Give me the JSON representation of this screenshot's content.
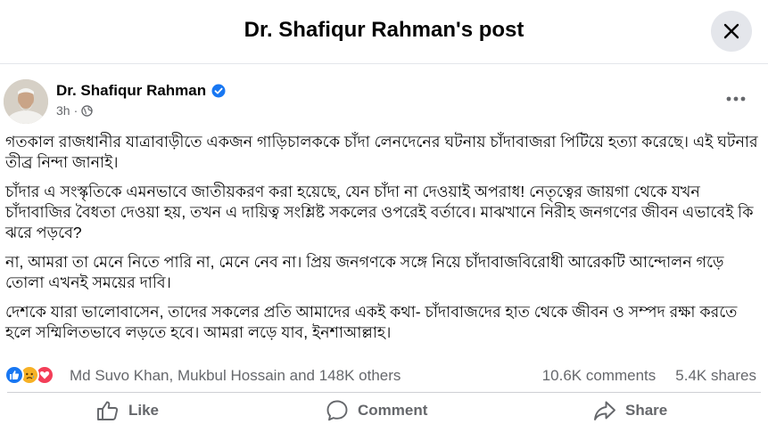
{
  "header": {
    "title": "Dr. Shafiqur Rahman's post",
    "close_icon": "close-icon"
  },
  "post": {
    "author": "Dr. Shafiqur Rahman",
    "time": "3h",
    "separator": "·",
    "audience_icon": "globe-icon",
    "paragraphs": [
      "গতকাল রাজধানীর যাত্রাবাড়ীতে একজন গাড়িচালককে চাঁদা লেনদেনের ঘটনায় চাঁদাবাজরা পিটিয়ে হত্যা করেছে। এই ঘটনার তীব্র নিন্দা জানাই।",
      "চাঁদার এ সংস্কৃতিকে এমনভাবে জাতীয়করণ করা হয়েছে, যেন চাঁদা না দেওয়াই অপরাধ! নেতৃত্বের জায়গা থেকে যখন চাঁদাবাজির বৈধতা দেওয়া হয়, তখন এ দায়িত্ব সংশ্লিষ্ট সকলের ওপরেই বর্তাবে। মাঝখানে নিরীহ জনগণের জীবন এভাবেই কি ঝরে পড়বে?",
      "না, আমরা তা মেনে নিতে পারি না, মেনে নেব না। প্রিয় জনগণকে সঙ্গে নিয়ে চাঁদাবাজবিরোধী আরেকটি আন্দোলন গড়ে তোলা এখনই সময়ের দাবি।",
      "দেশকে যারা ভালোবাসেন, তাদের সকলের প্রতি আমাদের একই কথা- চাঁদাবাজদের হাত থেকে জীবন ও সম্পদ রক্ষা করতে হলে সম্মিলিতভাবে লড়তে হবে। আমরা লড়ে যাব, ইনশাআল্লাহ।"
    ]
  },
  "reactions": {
    "icons": [
      "like-reaction-icon",
      "sad-reaction-icon",
      "love-reaction-icon"
    ],
    "names": "Md Suvo Khan, Mukbul Hossain and 148K others",
    "comments": "10.6K comments",
    "shares": "5.4K shares"
  },
  "actions": {
    "like": "Like",
    "comment": "Comment",
    "share": "Share"
  },
  "colors": {
    "accent": "#1877f2",
    "secondary_text": "#65676b",
    "divider": "#ced0d4",
    "close_bg": "#e4e6eb"
  }
}
